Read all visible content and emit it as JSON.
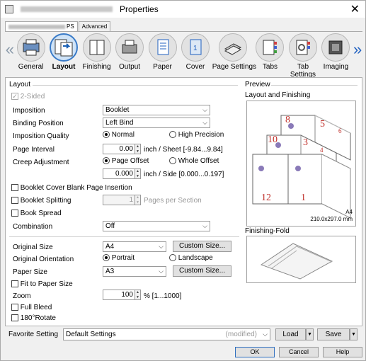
{
  "window": {
    "title": "Properties",
    "close_glyph": "✕"
  },
  "tabs": {
    "driver_tab": "PS",
    "advanced_tab": "Advanced"
  },
  "ribbon": {
    "items": [
      {
        "label": "General",
        "icon": "general-icon"
      },
      {
        "label": "Layout",
        "icon": "layout-icon",
        "selected": true
      },
      {
        "label": "Finishing",
        "icon": "finishing-icon"
      },
      {
        "label": "Output",
        "icon": "output-icon"
      },
      {
        "label": "Paper",
        "icon": "paper-icon"
      },
      {
        "label": "Cover",
        "icon": "cover-icon"
      },
      {
        "label": "Page Settings",
        "icon": "page-settings-icon"
      },
      {
        "label": "Tabs",
        "icon": "tabs-icon"
      },
      {
        "label": "Tab Settings",
        "icon": "tab-settings-icon"
      },
      {
        "label": "Imaging",
        "icon": "imaging-icon"
      }
    ]
  },
  "layout": {
    "section_title": "Layout",
    "two_sided": {
      "label": "2-Sided",
      "checked": true,
      "disabled": true
    },
    "imposition": {
      "label": "Imposition",
      "value": "Booklet"
    },
    "binding_position": {
      "label": "Binding Position",
      "value": "Left Bind"
    },
    "imposition_quality": {
      "label": "Imposition Quality",
      "opt1": "Normal",
      "opt2": "High Precision",
      "selected": "Normal"
    },
    "page_interval": {
      "label": "Page Interval",
      "value": "0.00",
      "unit": "inch / Sheet [-9.84...9.84]"
    },
    "creep_adjustment": {
      "label": "Creep Adjustment",
      "opt1": "Page Offset",
      "opt2": "Whole Offset",
      "selected": "Page Offset",
      "value": "0.000",
      "unit": "inch / Side [0.000...0.197]"
    },
    "booklet_cover_blank": {
      "label": "Booklet Cover Blank Page Insertion"
    },
    "booklet_splitting": {
      "label": "Booklet Splitting",
      "value": "1",
      "unit": "Pages per Section"
    },
    "book_spread": {
      "label": "Book Spread"
    },
    "combination": {
      "label": "Combination",
      "value": "Off"
    },
    "original_size": {
      "label": "Original Size",
      "value": "A4",
      "button": "Custom Size..."
    },
    "original_orientation": {
      "label": "Original Orientation",
      "opt1": "Portrait",
      "opt2": "Landscape",
      "selected": "Portrait"
    },
    "paper_size": {
      "label": "Paper Size",
      "value": "A3",
      "button": "Custom Size..."
    },
    "fit_to_paper": {
      "label": "Fit to Paper Size"
    },
    "zoom": {
      "label": "Zoom",
      "value": "100",
      "unit": "% [1...1000]"
    },
    "full_bleed": {
      "label": "Full Bleed"
    },
    "rotate_180": {
      "label": "180°Rotate"
    }
  },
  "preview": {
    "section_title": "Preview",
    "layout_finishing_title": "Layout and Finishing",
    "paper_name": "A4",
    "paper_dims": "210.0x297.0 mm",
    "finishing_fold_title": "Finishing-Fold",
    "page_numbers": [
      "8",
      "5",
      "6",
      "10",
      "3",
      "4",
      "12",
      "1"
    ]
  },
  "favorite": {
    "label": "Favorite Setting",
    "value": "Default Settings",
    "status": "(modified)",
    "load": "Load",
    "save": "Save"
  },
  "footer": {
    "ok": "OK",
    "cancel": "Cancel",
    "help": "Help"
  },
  "colors": {
    "accent": "#3a7bc8",
    "page_number": "#c0302b"
  }
}
